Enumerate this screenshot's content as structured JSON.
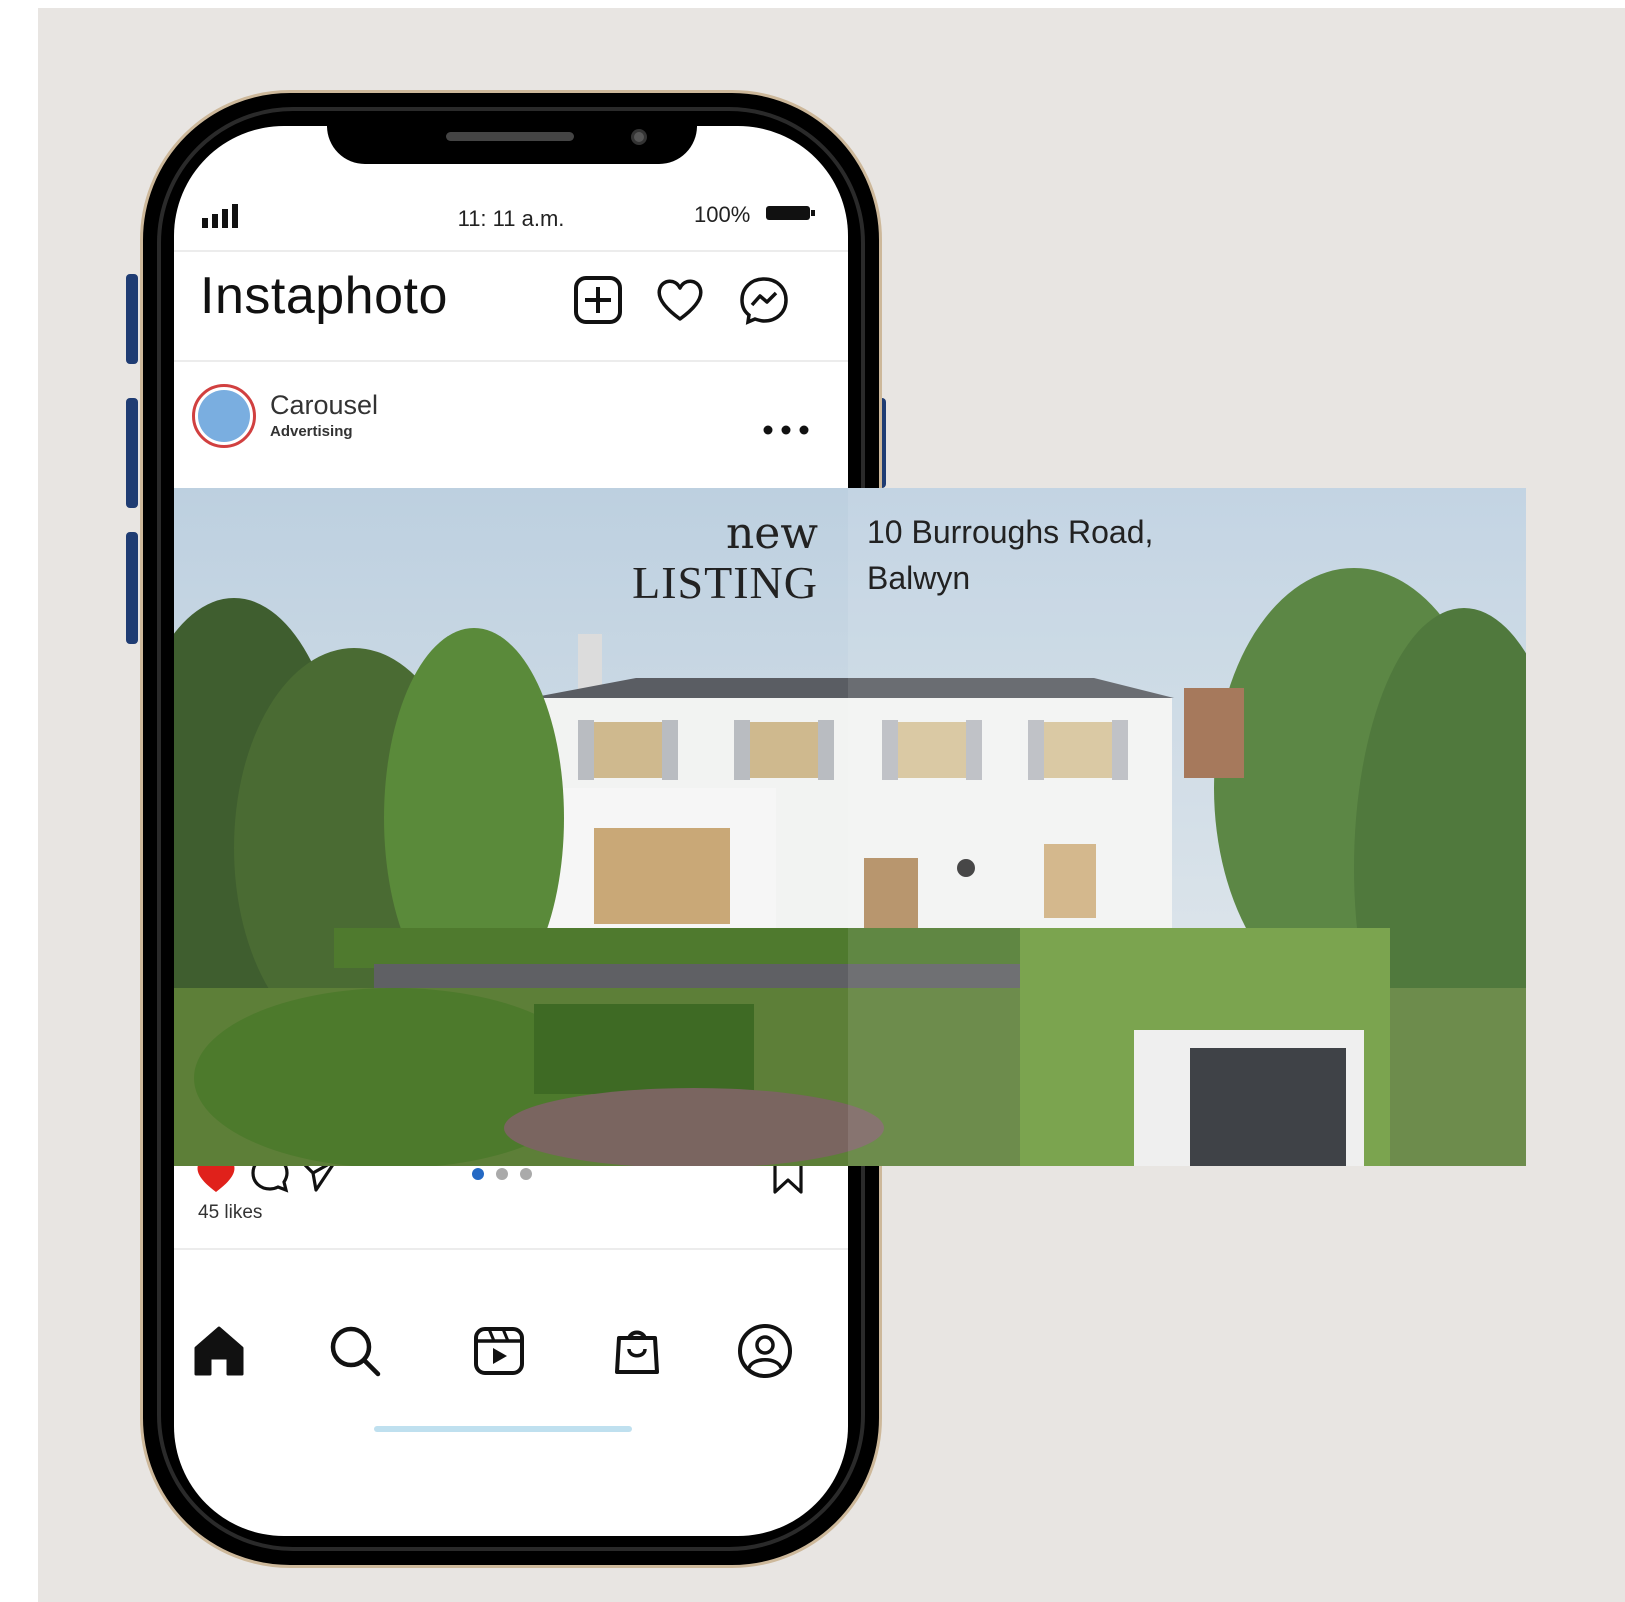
{
  "status_bar": {
    "time": "11: 11 a.m.",
    "battery": "100%"
  },
  "header": {
    "app_title": "Instaphoto",
    "icons": [
      "add-post-icon",
      "heart-icon",
      "messenger-icon"
    ]
  },
  "post": {
    "account_name": "Carousel",
    "account_subtitle": "Advertising",
    "image_headline_1": "new",
    "image_headline_2": "LISTING",
    "address_line_1": "10 Burroughs Road,",
    "address_line_2": "Balwyn",
    "likes": "45 likes",
    "carousel_page": 1,
    "carousel_pages": 3,
    "liked": true
  },
  "bottom_nav": {
    "icons": [
      "home-icon",
      "search-icon",
      "reels-icon",
      "shop-icon",
      "profile-icon"
    ]
  },
  "colors": {
    "background": "#e8e5e2",
    "like_red": "#e0211b",
    "dot_active": "#2469c4",
    "phone_button": "#1f3c73"
  }
}
